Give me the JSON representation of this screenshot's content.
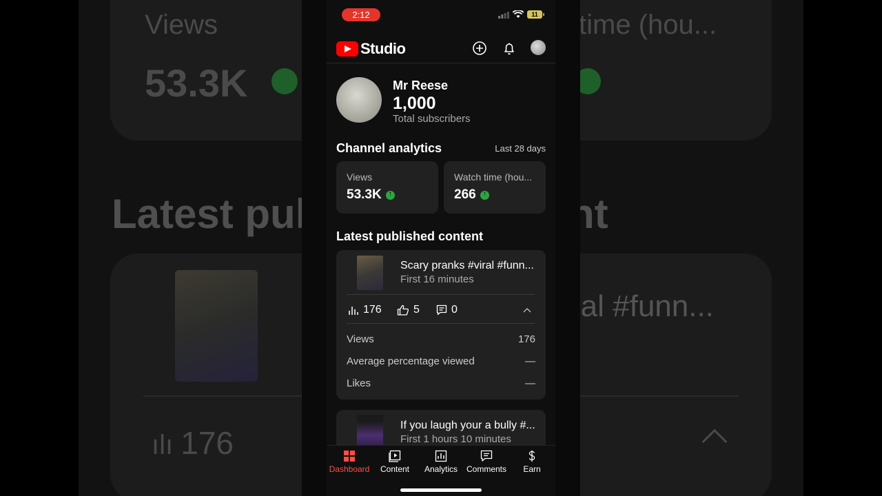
{
  "status": {
    "time": "2:12",
    "battery": "11"
  },
  "appbar": {
    "logo_text": "Studio"
  },
  "channel": {
    "name": "Mr Reese",
    "subscribers": "1,000",
    "subscribers_label": "Total subscribers"
  },
  "analytics": {
    "title": "Channel analytics",
    "period": "Last 28 days",
    "views_label": "Views",
    "views_value": "53.3K",
    "watch_label": "Watch time (hou...",
    "watch_value": "266"
  },
  "latest": {
    "title": "Latest published content",
    "items": [
      {
        "title": "Scary pranks #viral #funn...",
        "subtitle": "First 16 minutes",
        "views": "176",
        "likes": "5",
        "comments": "0",
        "details": [
          {
            "label": "Views",
            "value": "176"
          },
          {
            "label": "Average percentage viewed",
            "value": "—"
          },
          {
            "label": "Likes",
            "value": "—"
          }
        ]
      },
      {
        "title": "If you laugh your a bully #...",
        "subtitle": "First 1 hours 10 minutes"
      }
    ]
  },
  "nav": [
    "Dashboard",
    "Content",
    "Analytics",
    "Comments",
    "Earn"
  ],
  "background": {
    "views_label": "Views",
    "views_value": "53.3K",
    "watch_label": "time (hou...",
    "latest_left": "Latest pul",
    "latest_right": "nt",
    "title_right": "ral #funn...",
    "stat_value": "176"
  },
  "colors": {
    "accent": "#ff4e45",
    "up": "#2ba640",
    "card": "#212121"
  }
}
